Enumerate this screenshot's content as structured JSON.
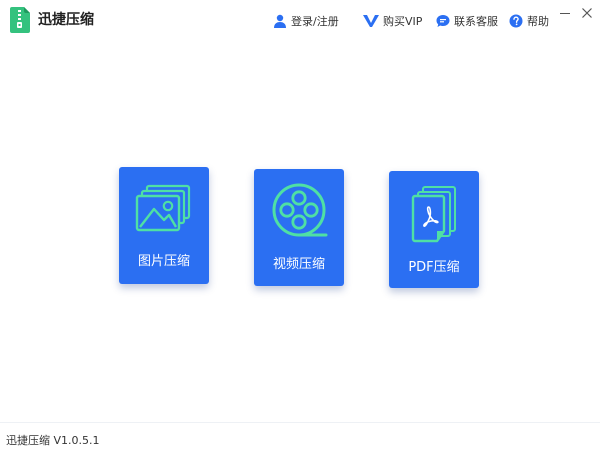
{
  "app": {
    "title": "迅捷压缩"
  },
  "nav": {
    "login": "登录/注册",
    "vip": "购买VIP",
    "contact": "联系客服",
    "help": "帮助"
  },
  "icons": {
    "logo": "zip-file-icon",
    "login": "user-icon",
    "vip": "vip-v-icon",
    "contact": "chat-bubble-icon",
    "help": "question-circle-icon",
    "image": "image-stack-icon",
    "video": "film-reel-icon",
    "pdf": "pdf-document-icon"
  },
  "cards": [
    {
      "label": "图片压缩"
    },
    {
      "label": "视频压缩"
    },
    {
      "label": "PDF压缩"
    }
  ],
  "footer": {
    "version": "迅捷压缩 V1.0.5.1"
  },
  "colors": {
    "card": "#2b6ff2",
    "icon_accent": "#4fe0a4",
    "nav_icon": "#2b6ff2"
  }
}
